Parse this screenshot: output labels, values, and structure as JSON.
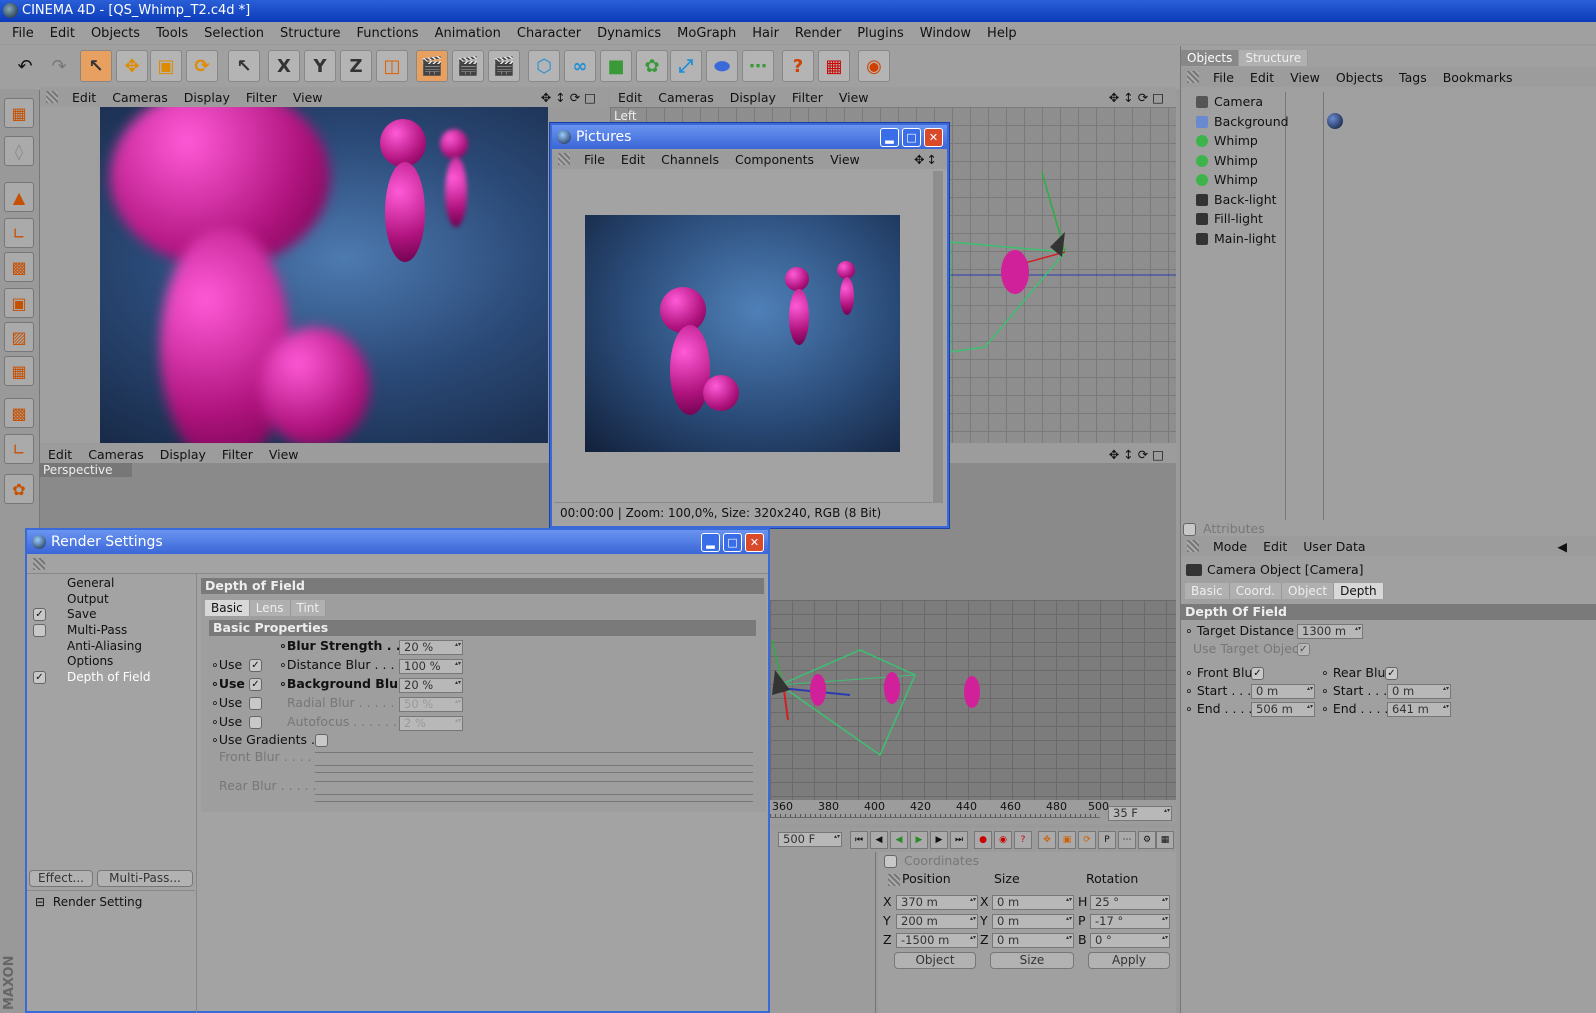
{
  "app": {
    "title": "CINEMA 4D - [QS_Whimp_T2.c4d *]"
  },
  "menu": [
    "File",
    "Edit",
    "Objects",
    "Tools",
    "Selection",
    "Structure",
    "Functions",
    "Animation",
    "Character",
    "Dynamics",
    "MoGraph",
    "Hair",
    "Render",
    "Plugins",
    "Window",
    "Help"
  ],
  "viewport_menu": [
    "Edit",
    "Cameras",
    "Display",
    "Filter",
    "View"
  ],
  "viewports": {
    "top_right_label": "Left",
    "bottom_label": "Perspective"
  },
  "pictures": {
    "title": "Pictures",
    "menu": [
      "File",
      "Edit",
      "Channels",
      "Components",
      "View"
    ],
    "status": "00:00:00 | Zoom: 100,0%, Size: 320x240, RGB (8 Bit)"
  },
  "render_settings": {
    "title": "Render Settings",
    "nav": [
      {
        "label": "General",
        "checked": null
      },
      {
        "label": "Output",
        "checked": null
      },
      {
        "label": "Save",
        "checked": true
      },
      {
        "label": "Multi-Pass",
        "checked": false
      },
      {
        "label": "Anti-Aliasing",
        "checked": null
      },
      {
        "label": "Options",
        "checked": null
      },
      {
        "label": "Depth of Field",
        "checked": true
      }
    ],
    "buttons": {
      "effect": "Effect...",
      "multipass": "Multi-Pass..."
    },
    "footer_item": "Render Setting",
    "section": "Depth of Field",
    "tabs": [
      "Basic",
      "Lens",
      "Tint"
    ],
    "subsection": "Basic Properties",
    "props": {
      "blur_strength": {
        "label": "Blur Strength",
        "value": "20 %"
      },
      "distance_blur": {
        "label": "Distance Blur",
        "value": "100 %"
      },
      "background_blur": {
        "label": "Background Blur",
        "value": "20 %"
      },
      "radial_blur": {
        "label": "Radial Blur",
        "value": "50 %"
      },
      "autofocus": {
        "label": "Autofocus",
        "value": "2 %"
      },
      "use_gradients": "Use Gradients",
      "front_blur": "Front Blur",
      "rear_blur": "Rear Blur",
      "use": "Use"
    }
  },
  "objects_panel": {
    "tabs": [
      "Objects",
      "Structure"
    ],
    "menu": [
      "File",
      "Edit",
      "View",
      "Objects",
      "Tags",
      "Bookmarks"
    ],
    "items": [
      {
        "name": "Camera",
        "color": "#cfcfcf"
      },
      {
        "name": "Background",
        "color": "#cfcfcf"
      },
      {
        "name": "Whimp",
        "color": "#3cb44a"
      },
      {
        "name": "Whimp",
        "color": "#3cb44a"
      },
      {
        "name": "Whimp",
        "color": "#3cb44a"
      },
      {
        "name": "Back-light",
        "color": "#d0d0d0"
      },
      {
        "name": "Fill-light",
        "color": "#d0d0d0"
      },
      {
        "name": "Main-light",
        "color": "#d0d0d0"
      }
    ]
  },
  "attributes": {
    "header": "Attributes",
    "menu": [
      "Mode",
      "Edit",
      "User Data"
    ],
    "object": "Camera Object [Camera]",
    "tabs": [
      "Basic",
      "Coord.",
      "Object",
      "Depth"
    ],
    "section": "Depth Of Field",
    "target_distance": {
      "label": "Target Distance",
      "value": "1300 m"
    },
    "use_target_object": "Use Target Object",
    "front_blur": "Front Blur",
    "rear_blur": "Rear Blur",
    "start_label": "Start",
    "end_label": "End",
    "front_start": "0 m",
    "front_end": "506 m",
    "rear_start": "0 m",
    "rear_end": "641 m"
  },
  "timeline": {
    "ticks": [
      "360",
      "380",
      "400",
      "420",
      "440",
      "460",
      "480",
      "500"
    ],
    "current_frame": "35 F",
    "end_frame": "500 F"
  },
  "coordinates": {
    "header": "Coordinates",
    "cols": [
      "Position",
      "Size",
      "Rotation"
    ],
    "rows": [
      {
        "axis": "X",
        "pos": "370 m",
        "size_axis": "X",
        "size": "0 m",
        "rot_axis": "H",
        "rot": "25 °"
      },
      {
        "axis": "Y",
        "pos": "200 m",
        "size_axis": "Y",
        "size": "0 m",
        "rot_axis": "P",
        "rot": "-17 °"
      },
      {
        "axis": "Z",
        "pos": "-1500 m",
        "size_axis": "Z",
        "size": "0 m",
        "rot_axis": "B",
        "rot": "0 °"
      }
    ],
    "mode": "Object",
    "size_mode": "Size",
    "apply": "Apply"
  },
  "brand": "MAXON"
}
